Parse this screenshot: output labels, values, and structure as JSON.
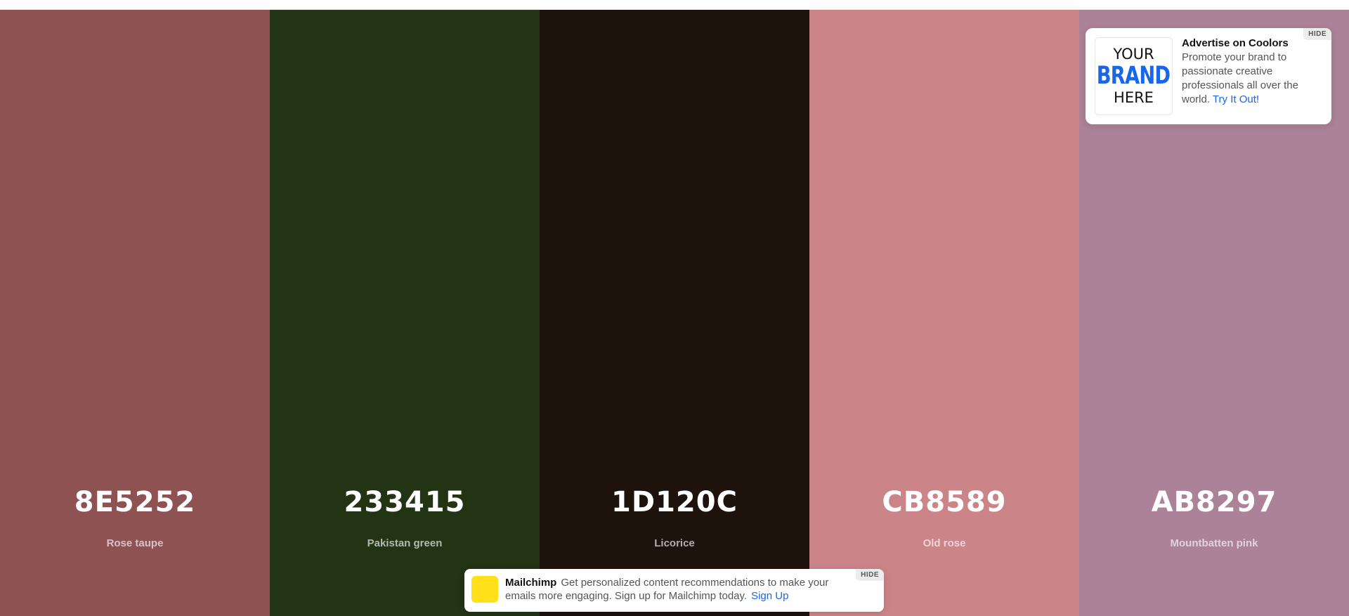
{
  "swatches": [
    {
      "hex": "8E5252",
      "name": "Rose taupe",
      "color": "#8E5252"
    },
    {
      "hex": "233415",
      "name": "Pakistan green",
      "color": "#233415"
    },
    {
      "hex": "1D120C",
      "name": "Licorice",
      "color": "#1D120C"
    },
    {
      "hex": "CB8589",
      "name": "Old rose",
      "color": "#CB8589"
    },
    {
      "hex": "AB8297",
      "name": "Mountbatten pink",
      "color": "#AB8297"
    }
  ],
  "ad": {
    "logo_line1": "YOUR",
    "logo_line2": "BRAND",
    "logo_line3": "HERE",
    "title": "Advertise on Coolors",
    "body": "Promote your brand to passionate creative professionals all over the world.",
    "link": "Try It Out!",
    "hide_label": "HIDE",
    "brand_color": "#1a66e8"
  },
  "mailchimp": {
    "brand": "Mailchimp",
    "body": "Get personalized content recommendations to make your emails more engaging. Sign up for Mailchimp today.",
    "link": "Sign Up",
    "hide_label": "HIDE",
    "logo_color": "#ffe01b"
  }
}
